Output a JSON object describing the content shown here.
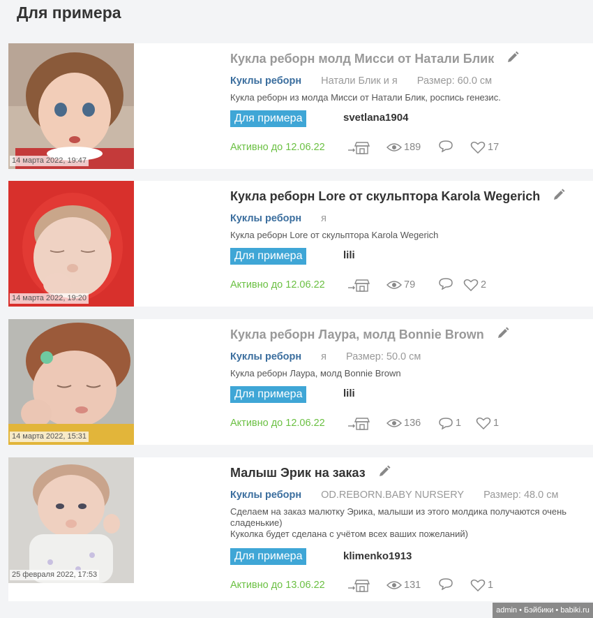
{
  "page": {
    "title": "Для примера"
  },
  "items": [
    {
      "date": "14 марта 2022, 19:47",
      "title": "Кукла реборн молд Мисси от Натали Блик",
      "category": "Куклы реборн",
      "author": "Натали Блик и я",
      "size": "Размер: 60.0 см",
      "description": "Кукла реборн из молда Мисси от Натали Блик, роспись генезис.",
      "badge": "Для примера",
      "user": "svetlana1904",
      "active": "Активно до 12.06.22",
      "views": "189",
      "comments": "",
      "likes": "17"
    },
    {
      "date": "14 марта 2022, 19:20",
      "title": "Кукла реборн Lore от скульптора Karola Wegerich",
      "category": "Куклы реборн",
      "author": "я",
      "size": "",
      "description": "Кукла реборн Lore от скульптора Karola Wegerich",
      "badge": "Для примера",
      "user": "lili",
      "active": "Активно до 12.06.22",
      "views": "79",
      "comments": "",
      "likes": "2"
    },
    {
      "date": "14 марта 2022, 15:31",
      "title": "Кукла реборн Лаура, молд Bonnie Brown",
      "category": "Куклы реборн",
      "author": "я",
      "size": "Размер: 50.0 см",
      "description": "Кукла реборн Лаура, молд Bonnie Brown",
      "badge": "Для примера",
      "user": "lili",
      "active": "Активно до 12.06.22",
      "views": "136",
      "comments": "1",
      "likes": "1"
    },
    {
      "date": "25 февраля 2022, 17:53",
      "title": "Малыш Эрик на заказ",
      "category": "Куклы реборн",
      "author": "OD.REBORN.BABY NURSERY",
      "size": "Размер: 48.0 см",
      "description": "Сделаем на заказ малютку Эрика, малыши из этого молдика получаются очень сладенькие)\nКуколка будет сделана с учётом всех ваших пожеланий)",
      "badge": "Для примера",
      "user": "klimenko1913",
      "active": "Активно до 13.06.22",
      "views": "131",
      "comments": "",
      "likes": "1"
    }
  ],
  "watermark": "admin • Бэйбики • babiki.ru",
  "colors": {
    "accent": "#3fa6d6",
    "category": "#3b6e9e",
    "active": "#6bc043"
  }
}
